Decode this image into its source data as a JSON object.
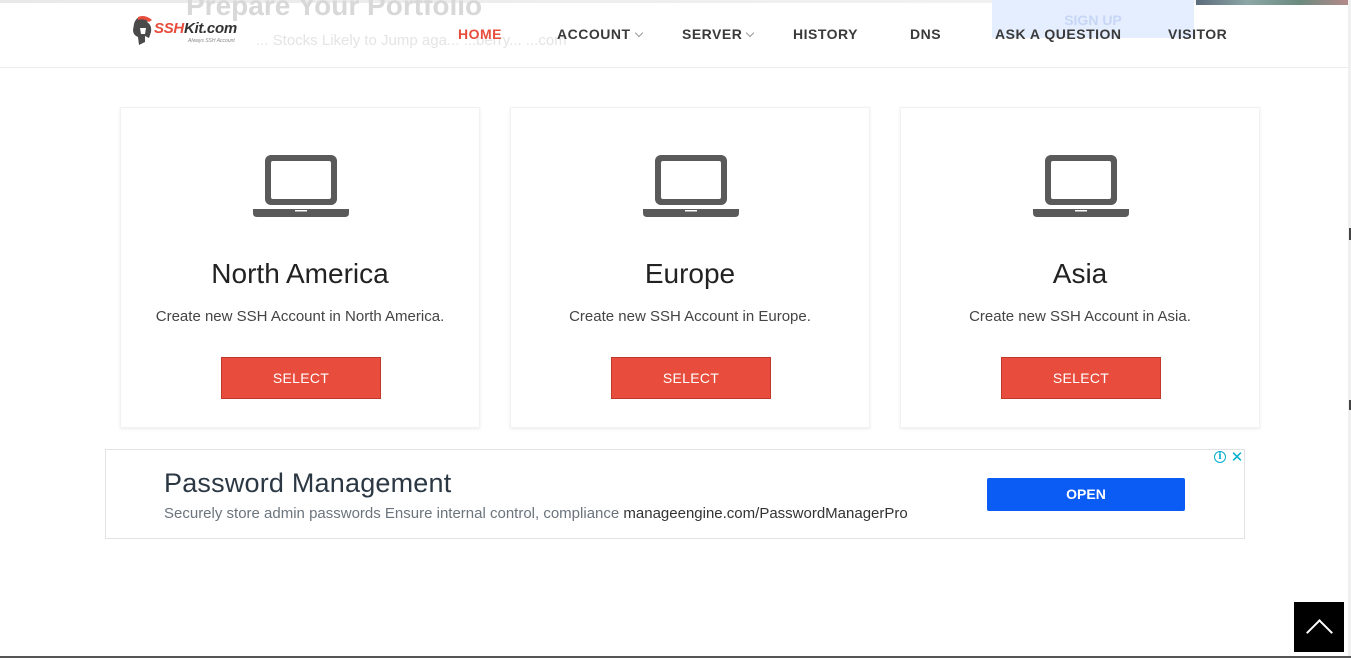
{
  "background_ad": {
    "title": "Prepare Your Portfolio",
    "subtitle": "... Stocks Likely to Jump aga... ...berry... ...com",
    "button": "SIGN UP"
  },
  "header": {
    "logo_text": "SSHKit.com",
    "logo_tagline": "Always SSH Account",
    "nav": [
      {
        "label": "HOME",
        "active": true
      },
      {
        "label": "ACCOUNT",
        "dropdown": true
      },
      {
        "label": "SERVER",
        "dropdown": true
      },
      {
        "label": "HISTORY"
      },
      {
        "label": "DNS"
      },
      {
        "label": "ASK A QUESTION"
      },
      {
        "label": "VISITOR"
      }
    ]
  },
  "regions": [
    {
      "icon": "laptop-icon",
      "name": "North America",
      "description": "Create new SSH Account in North America.",
      "button": "SELECT"
    },
    {
      "icon": "laptop-icon",
      "name": "Europe",
      "description": "Create new SSH Account in Europe.",
      "button": "SELECT"
    },
    {
      "icon": "laptop-icon",
      "name": "Asia",
      "description": "Create new SSH Account in Asia.",
      "button": "SELECT"
    }
  ],
  "ad": {
    "title": "Password Management",
    "description": "Securely store admin passwords Ensure internal control, compliance",
    "url": "manageengine.com/PasswordManagerPro",
    "button": "OPEN",
    "info_icon": "info-icon",
    "close_icon": "close-icon"
  },
  "scroll_top": {
    "icon": "chevron-up-icon"
  },
  "colors": {
    "accent": "#e74c3c",
    "ad_button": "#0a5cf5",
    "ad_icons": "#00aecd",
    "text_dark": "#222222"
  }
}
